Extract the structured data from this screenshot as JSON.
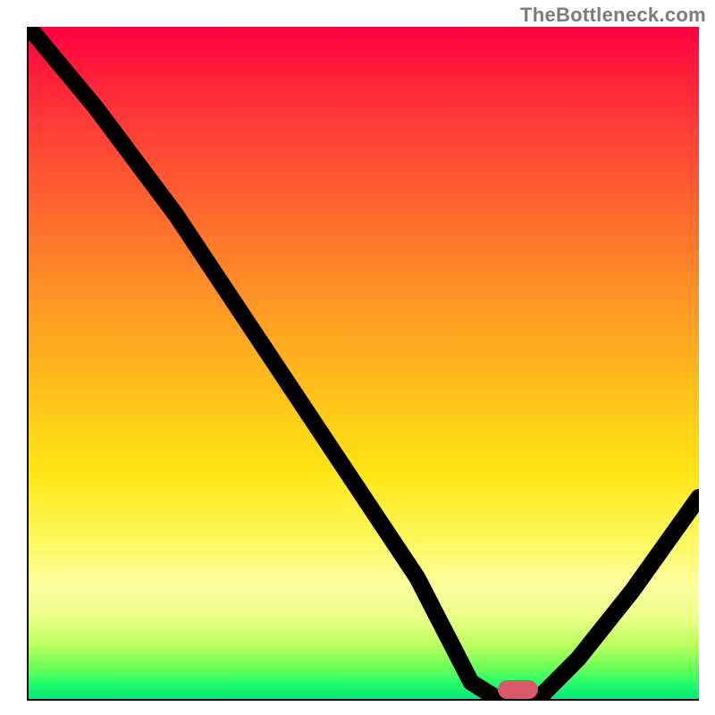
{
  "watermark": "TheBottleneck.com",
  "chart_data": {
    "type": "line",
    "title": "",
    "xlabel": "",
    "ylabel": "",
    "xlim": [
      0,
      100
    ],
    "ylim": [
      0,
      100
    ],
    "series": [
      {
        "name": "bottleneck-curve",
        "x": [
          0,
          10,
          22,
          34,
          46,
          58,
          66,
          70,
          72,
          76,
          82,
          90,
          100
        ],
        "y": [
          100,
          88,
          72,
          54,
          36,
          18,
          2.5,
          0,
          0,
          0,
          6,
          16,
          30
        ]
      }
    ],
    "marker": {
      "name": "optimal-point",
      "x": 73,
      "y": 0,
      "width": 6,
      "height": 2.8,
      "color": "#d85a6a"
    },
    "background": {
      "type": "vertical-gradient",
      "stops": [
        {
          "pct": 0,
          "color": "#ff0040"
        },
        {
          "pct": 28,
          "color": "#ff6a2e"
        },
        {
          "pct": 55,
          "color": "#ffc31a"
        },
        {
          "pct": 76,
          "color": "#fff85a"
        },
        {
          "pct": 92,
          "color": "#b9ff5e"
        },
        {
          "pct": 100,
          "color": "#00e77a"
        }
      ]
    }
  }
}
